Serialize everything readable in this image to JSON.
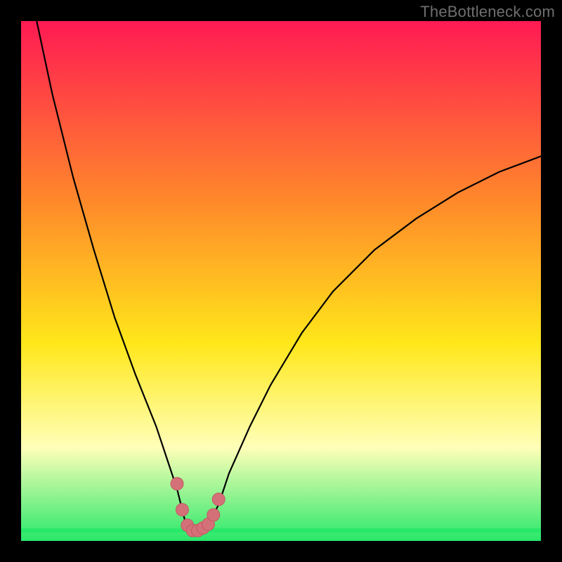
{
  "watermark": "TheBottleneck.com",
  "colors": {
    "gradient_top": "#ff1a53",
    "gradient_mid1": "#ff8a2a",
    "gradient_mid2": "#ffe71a",
    "gradient_mid3": "#ffffb8",
    "gradient_bottom": "#28e86a",
    "curve": "#000000",
    "marker": "#d47078",
    "frame": "#000000"
  },
  "chart_data": {
    "type": "line",
    "title": "",
    "xlabel": "",
    "ylabel": "",
    "xlim": [
      0,
      100
    ],
    "ylim": [
      0,
      100
    ],
    "grid": false,
    "legend": false,
    "series": [
      {
        "name": "bottleneck-curve",
        "x": [
          3,
          6,
          10,
          14,
          18,
          22,
          26,
          28,
          30,
          31.5,
          33,
          34.5,
          36,
          38,
          40,
          44,
          48,
          54,
          60,
          68,
          76,
          84,
          92,
          100
        ],
        "y": [
          100,
          86,
          70,
          56,
          43,
          32,
          22,
          16,
          10,
          4,
          2,
          2,
          3,
          7,
          13,
          22,
          30,
          40,
          48,
          56,
          62,
          67,
          71,
          74
        ]
      }
    ],
    "markers": {
      "name": "highlight-points",
      "x": [
        30,
        31,
        32,
        33,
        34,
        35,
        36,
        37,
        38
      ],
      "y": [
        11,
        6,
        3,
        2,
        2,
        2.5,
        3.2,
        5,
        8
      ]
    },
    "baseline_y": 2
  }
}
